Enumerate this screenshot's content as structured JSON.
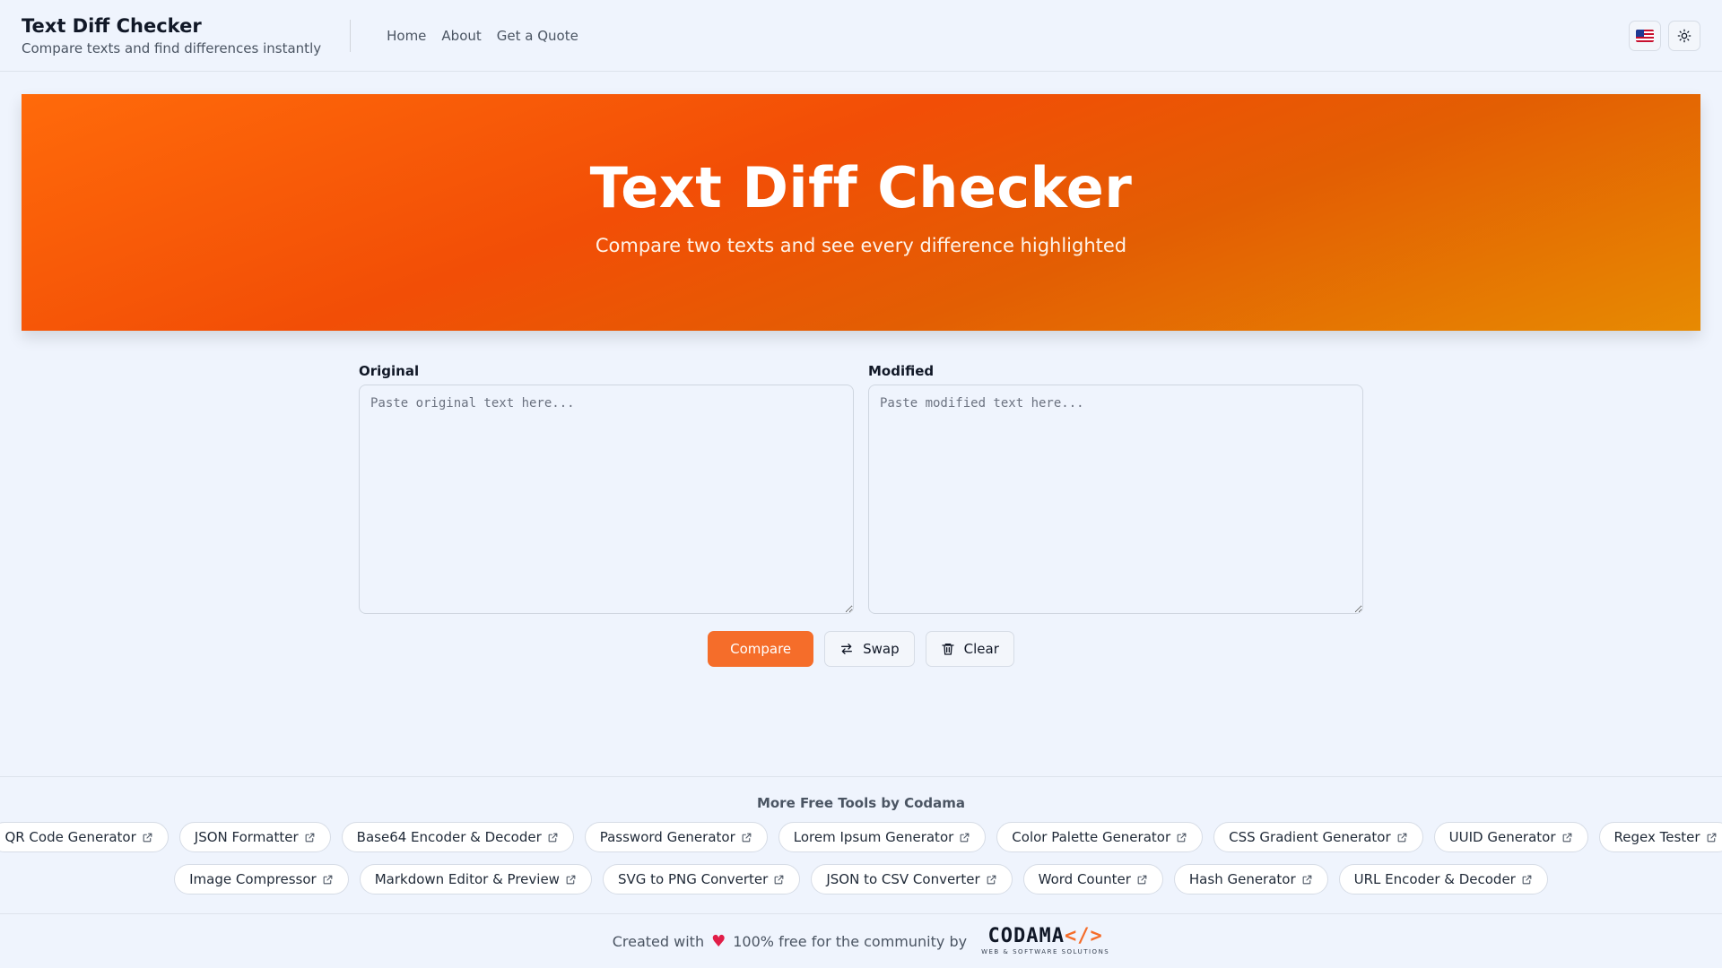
{
  "header": {
    "title": "Text Diff Checker",
    "subtitle": "Compare texts and find differences instantly",
    "nav": [
      "Home",
      "About",
      "Get a Quote"
    ]
  },
  "hero": {
    "title": "Text Diff Checker",
    "subtitle": "Compare two texts and see every difference highlighted"
  },
  "editors": {
    "original_label": "Original",
    "original_placeholder": "Paste original text here...",
    "original_value": "",
    "modified_label": "Modified",
    "modified_placeholder": "Paste modified text here...",
    "modified_value": ""
  },
  "actions": {
    "compare": "Compare",
    "swap": "Swap",
    "clear": "Clear"
  },
  "tools": {
    "title": "More Free Tools by Codama",
    "row1": [
      "QR Code Generator",
      "JSON Formatter",
      "Base64 Encoder & Decoder",
      "Password Generator",
      "Lorem Ipsum Generator",
      "Color Palette Generator",
      "CSS Gradient Generator",
      "UUID Generator",
      "Regex Tester"
    ],
    "row2": [
      "Image Compressor",
      "Markdown Editor & Preview",
      "SVG to PNG Converter",
      "JSON to CSV Converter",
      "Word Counter",
      "Hash Generator",
      "URL Encoder & Decoder"
    ]
  },
  "footer": {
    "created_with": "Created with",
    "heart": "♥",
    "free_text": "100% free for the community by",
    "logo_text": "CODAMA",
    "logo_symbol": "</>",
    "logo_tagline": "WEB & SOFTWARE SOLUTIONS"
  },
  "colors": {
    "accent": "#f56d2a",
    "hero_start": "#ff6a0a",
    "hero_end": "#e78a02",
    "background": "#eff4fd",
    "heart": "#e11d48"
  },
  "icons": [
    "flag-us-icon",
    "sun-icon",
    "swap-icon",
    "trash-icon",
    "external-link-icon",
    "heart-icon"
  ]
}
